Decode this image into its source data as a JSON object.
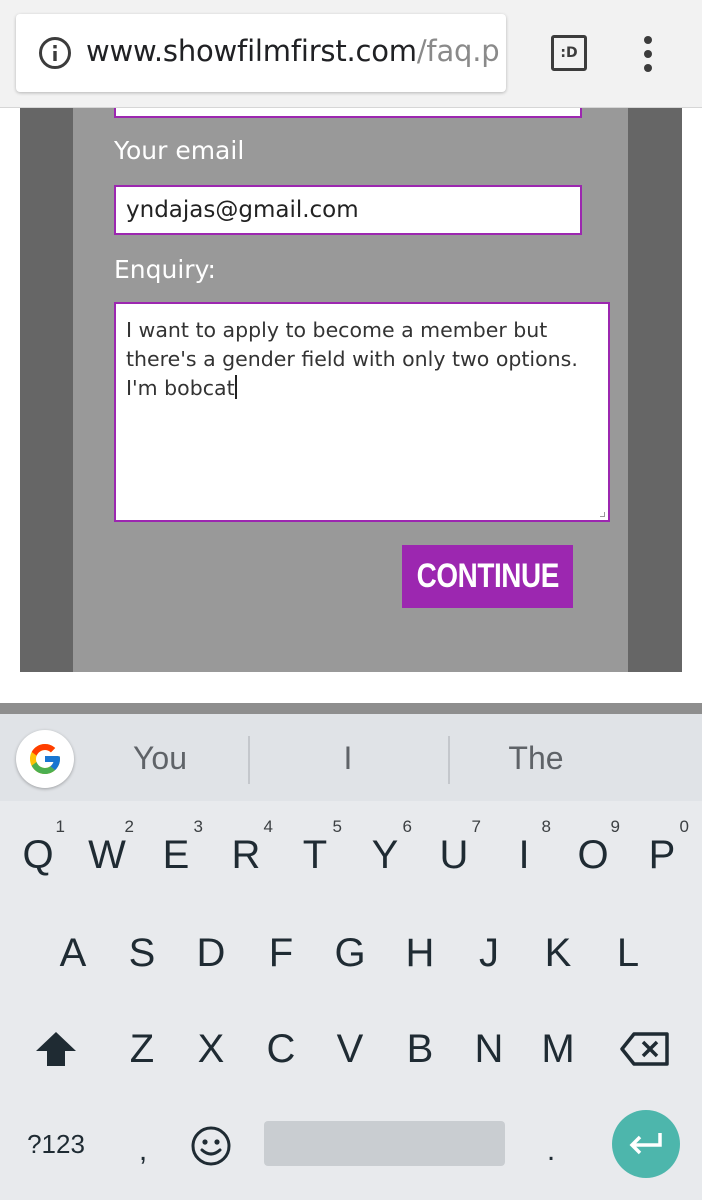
{
  "browser": {
    "url_host": "www.showfilmfirst.com",
    "url_path": "/faq.p",
    "tab_switcher_label": ":D",
    "icons": {
      "info": "info-icon",
      "menu": "more-vert-icon"
    }
  },
  "form": {
    "email_label": "Your email",
    "email_value": "yndajas@gmail.com",
    "enquiry_label": "Enquiry:",
    "enquiry_value": "I want to apply to become a member but\nthere's a gender field with only two options.\nI'm bobcat",
    "continue_label": "CONTINUE",
    "colors": {
      "accent": "#9c27b0",
      "frame_outer": "#666666",
      "frame_inner": "#999999"
    }
  },
  "keyboard": {
    "suggestions": [
      "You",
      "I",
      "The"
    ],
    "row1": [
      {
        "label": "Q",
        "hint": "1"
      },
      {
        "label": "W",
        "hint": "2"
      },
      {
        "label": "E",
        "hint": "3"
      },
      {
        "label": "R",
        "hint": "4"
      },
      {
        "label": "T",
        "hint": "5"
      },
      {
        "label": "Y",
        "hint": "6"
      },
      {
        "label": "U",
        "hint": "7"
      },
      {
        "label": "I",
        "hint": "8"
      },
      {
        "label": "O",
        "hint": "9"
      },
      {
        "label": "P",
        "hint": "0"
      }
    ],
    "row2": [
      "A",
      "S",
      "D",
      "F",
      "G",
      "H",
      "J",
      "K",
      "L"
    ],
    "row3": [
      "Z",
      "X",
      "C",
      "V",
      "B",
      "N",
      "M"
    ],
    "symbols_label": "?123",
    "comma_label": ",",
    "period_label": ".",
    "icons": {
      "google": "google-g-icon",
      "shift": "shift-icon",
      "backspace": "backspace-icon",
      "emoji": "emoji-icon",
      "enter": "enter-icon"
    },
    "colors": {
      "enter": "#4db6ac",
      "background": "#e8eaed"
    }
  }
}
